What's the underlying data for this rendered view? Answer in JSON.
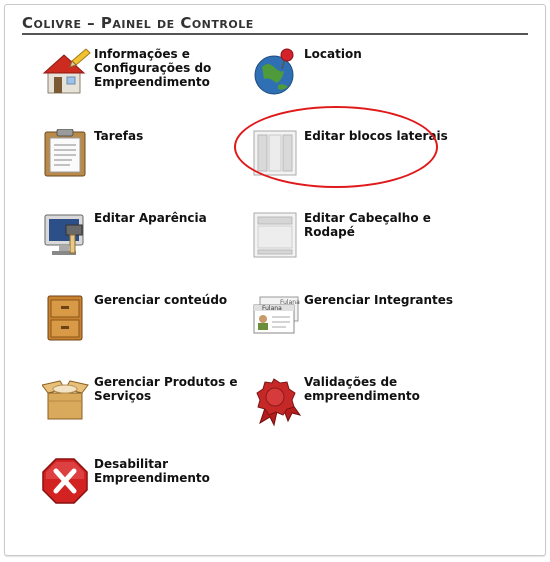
{
  "panel": {
    "title": "Colivre – Painel de Controle"
  },
  "items": [
    {
      "label": "Informações e Configurações do Empreendimento",
      "icon": "house-pencil-icon"
    },
    {
      "label": "Location",
      "icon": "globe-pin-icon"
    },
    {
      "label": "Tarefas",
      "icon": "clipboard-icon"
    },
    {
      "label": "Editar blocos laterais",
      "icon": "side-blocks-layout-icon"
    },
    {
      "label": "Editar Aparência",
      "icon": "monitor-paintbrush-icon"
    },
    {
      "label": "Editar Cabeçalho e Rodapé",
      "icon": "header-footer-layout-icon"
    },
    {
      "label": "Gerenciar conteúdo",
      "icon": "filing-cabinet-icon"
    },
    {
      "label": "Gerenciar Integrantes",
      "icon": "id-cards-icon"
    },
    {
      "label": "Gerenciar Produtos e Serviços",
      "icon": "open-box-icon"
    },
    {
      "label": "Validações de empreendimento",
      "icon": "wax-seal-icon"
    },
    {
      "label": "Desabilitar Empreendimento",
      "icon": "disable-x-icon"
    }
  ],
  "icon_text": {
    "id_card_name": "Fulana"
  },
  "colors": {
    "highlight": "#e01a1a",
    "title_rule": "#555555",
    "disable_red": "#d32222"
  }
}
